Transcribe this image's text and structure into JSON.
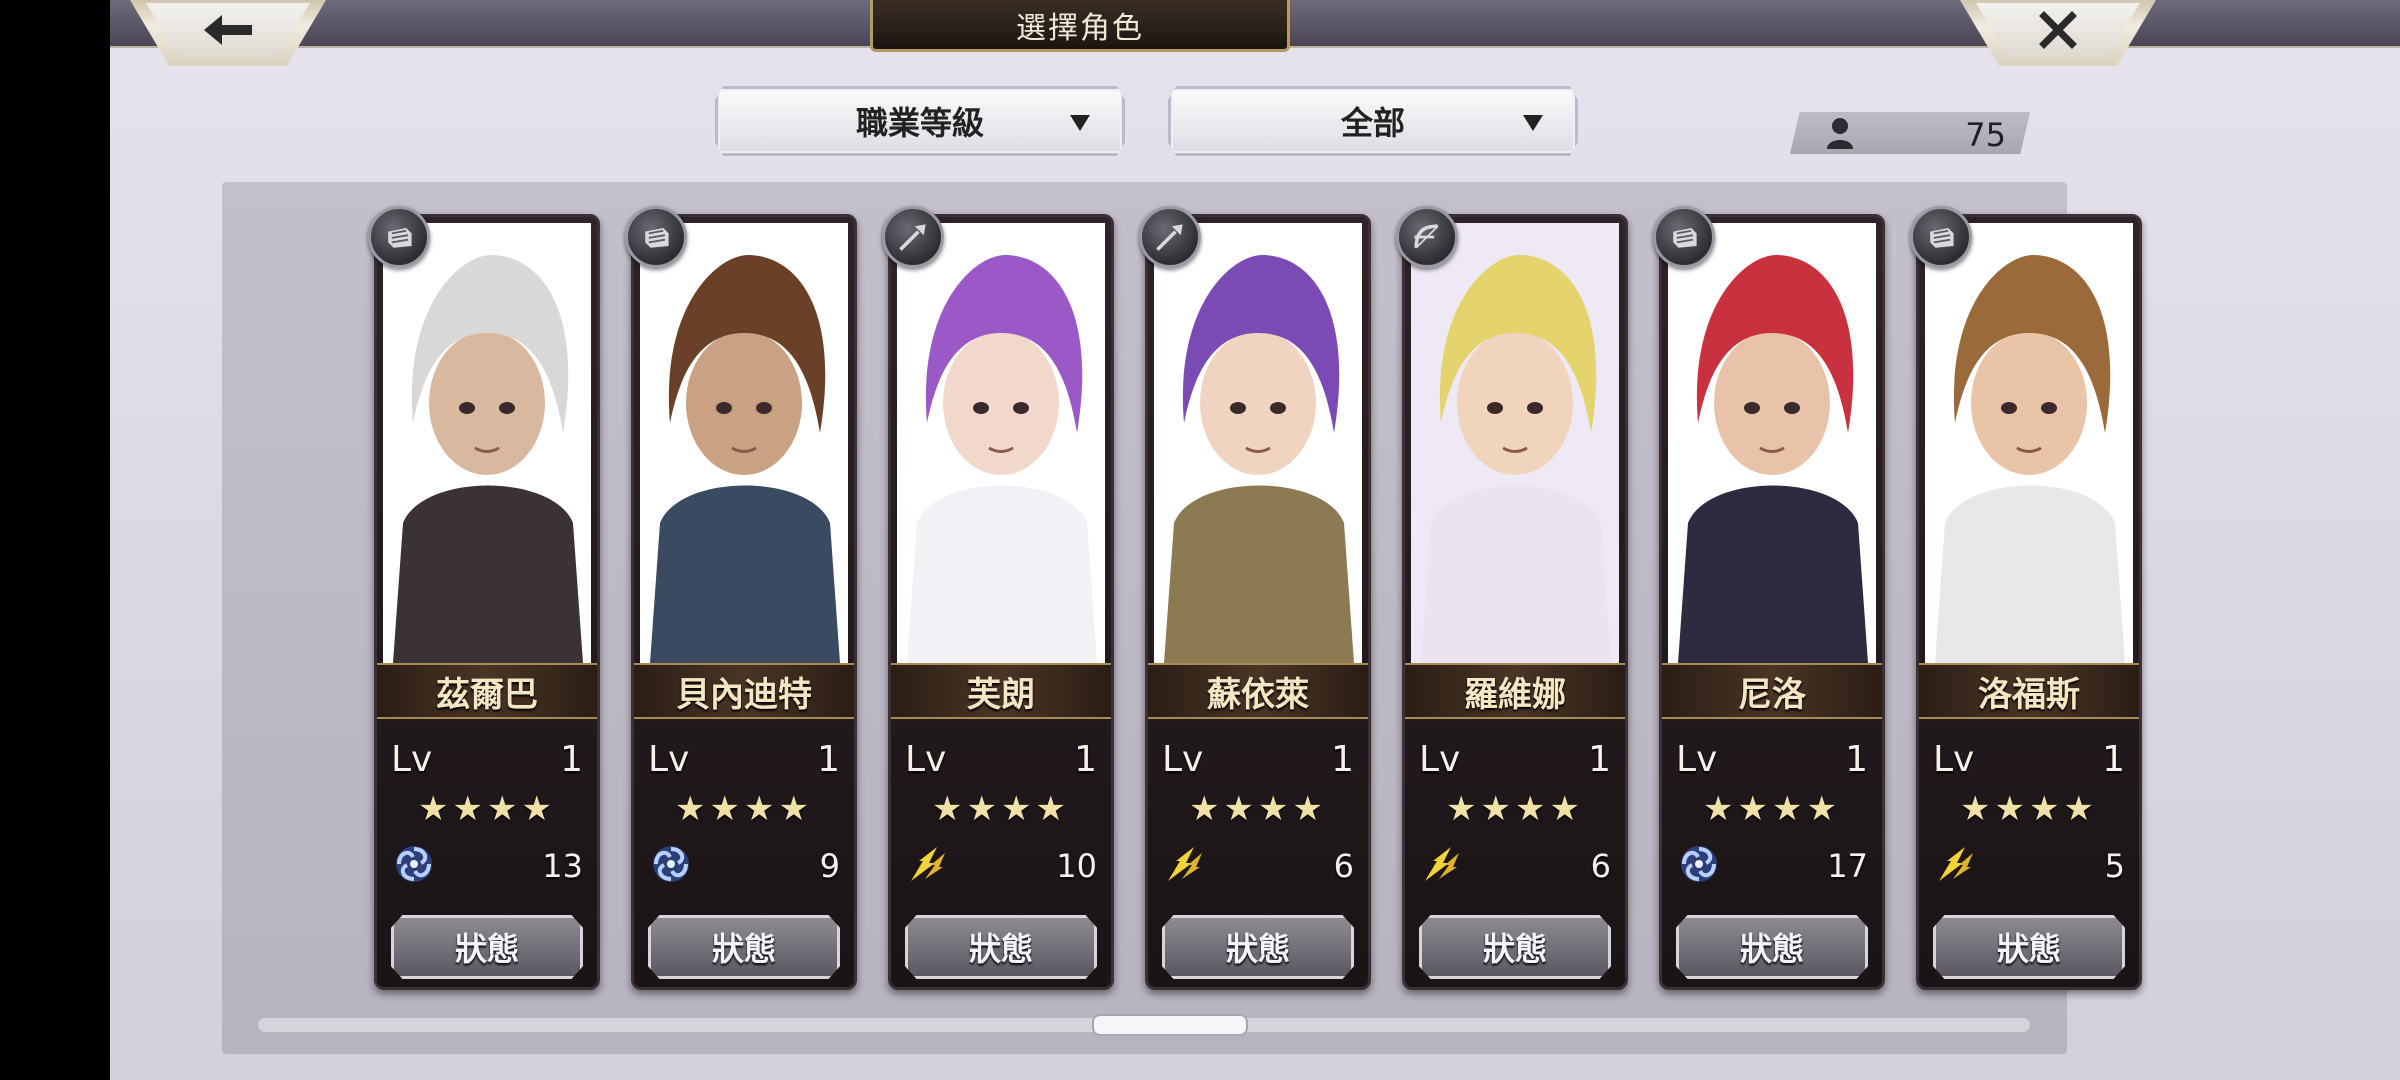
{
  "header": {
    "title": "選擇角色",
    "back_icon": "arrow-left-icon",
    "close_icon": "close-x-icon"
  },
  "filters": {
    "sort": {
      "label": "職業等級"
    },
    "category": {
      "label": "全部"
    }
  },
  "roster_count": "75",
  "characters": [
    {
      "name": "茲爾巴",
      "lv_label": "Lv",
      "level": "1",
      "stars": "★★★★",
      "element": "wind-swirl-icon",
      "element_value": "13",
      "status_label": "狀態",
      "class_icon": "fist-gauntlet-icon",
      "palette": {
        "hair": "#d9d8d6",
        "skin": "#d8b9a0",
        "outfit": "#3a3236",
        "bg": "#ffffff"
      }
    },
    {
      "name": "貝內迪特",
      "lv_label": "Lv",
      "level": "1",
      "stars": "★★★★",
      "element": "wind-swirl-icon",
      "element_value": "9",
      "status_label": "狀態",
      "class_icon": "fist-gauntlet-icon",
      "palette": {
        "hair": "#6b4028",
        "skin": "#c9a183",
        "outfit": "#3a4a60",
        "bg": "#ffffff"
      }
    },
    {
      "name": "芙朗",
      "lv_label": "Lv",
      "level": "1",
      "stars": "★★★★",
      "element": "lightning-wing-icon",
      "element_value": "10",
      "status_label": "狀態",
      "class_icon": "spear-icon",
      "palette": {
        "hair": "#9a59c7",
        "skin": "#f2d8cb",
        "outfit": "#f2f2f6",
        "bg": "#ffffff"
      }
    },
    {
      "name": "蘇依萊",
      "lv_label": "Lv",
      "level": "1",
      "stars": "★★★★",
      "element": "lightning-wing-icon",
      "element_value": "6",
      "status_label": "狀態",
      "class_icon": "spear-icon",
      "palette": {
        "hair": "#7b4ab5",
        "skin": "#f0d3c0",
        "outfit": "#8c7a52",
        "bg": "#ffffff"
      }
    },
    {
      "name": "羅維娜",
      "lv_label": "Lv",
      "level": "1",
      "stars": "★★★★",
      "element": "lightning-wing-icon",
      "element_value": "6",
      "status_label": "狀態",
      "class_icon": "bow-icon",
      "palette": {
        "hair": "#e5d46e",
        "skin": "#f1d4bc",
        "outfit": "#eae4ee",
        "bg": "#eee9f5"
      }
    },
    {
      "name": "尼洛",
      "lv_label": "Lv",
      "level": "1",
      "stars": "★★★★",
      "element": "wind-swirl-icon",
      "element_value": "17",
      "status_label": "狀態",
      "class_icon": "fist-gauntlet-icon",
      "palette": {
        "hair": "#c8313e",
        "skin": "#e8c2a9",
        "outfit": "#2d2b40",
        "bg": "#ffffff"
      }
    },
    {
      "name": "洛福斯",
      "lv_label": "Lv",
      "level": "1",
      "stars": "★★★★",
      "element": "lightning-wing-icon",
      "element_value": "5",
      "status_label": "狀態",
      "class_icon": "fist-gauntlet-icon",
      "palette": {
        "hair": "#9a6a3a",
        "skin": "#e9c4a6",
        "outfit": "#e8e8ea",
        "bg": "#ffffff"
      }
    }
  ]
}
